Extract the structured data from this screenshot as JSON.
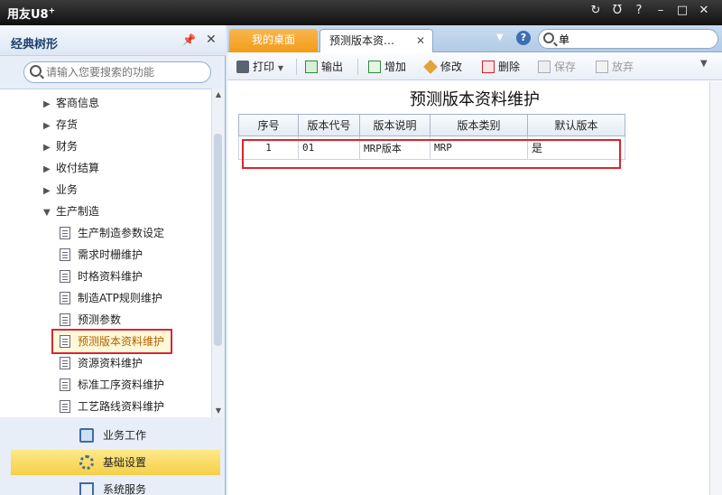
{
  "window": {
    "logo": "用友U8",
    "logo_sup": "+",
    "controls": [
      "↻",
      "Ʊ",
      "?",
      "–",
      "□",
      "✕"
    ]
  },
  "left_panel": {
    "title": "经典树形",
    "search_placeholder": "请输入您要搜索的功能",
    "tree": [
      {
        "label": "客商信息",
        "level": 1,
        "expanded": false
      },
      {
        "label": "存货",
        "level": 1,
        "expanded": false
      },
      {
        "label": "财务",
        "level": 1,
        "expanded": false
      },
      {
        "label": "收付结算",
        "level": 1,
        "expanded": false
      },
      {
        "label": "业务",
        "level": 1,
        "expanded": false
      },
      {
        "label": "生产制造",
        "level": 1,
        "expanded": true
      },
      {
        "label": "生产制造参数设定",
        "level": 2
      },
      {
        "label": "需求时栅维护",
        "level": 2
      },
      {
        "label": "时格资料维护",
        "level": 2
      },
      {
        "label": "制造ATP规则维护",
        "level": 2
      },
      {
        "label": "预测参数",
        "level": 2
      },
      {
        "label": "预测版本资料维护",
        "level": 2,
        "selected": true
      },
      {
        "label": "资源资料维护",
        "level": 2
      },
      {
        "label": "标准工序资料维护",
        "level": 2
      },
      {
        "label": "工艺路线资料维护",
        "level": 2
      }
    ],
    "nav_sections": [
      {
        "label": "业务工作",
        "icon": "briefcase-icon",
        "active": false
      },
      {
        "label": "基础设置",
        "icon": "gear-icon",
        "active": true
      },
      {
        "label": "系统服务",
        "icon": "service-icon",
        "active": false
      }
    ]
  },
  "tabs": [
    {
      "label": "我的桌面",
      "active": false
    },
    {
      "label": "预测版本资…",
      "active": true
    }
  ],
  "top_search": {
    "value": "单"
  },
  "toolbar": {
    "print": "打印",
    "export": "输出",
    "add": "增加",
    "edit": "修改",
    "delete": "删除",
    "save": "保存",
    "discard": "放弃"
  },
  "page": {
    "title": "预测版本资料维护",
    "columns": [
      "序号",
      "版本代号",
      "版本说明",
      "版本类别",
      "默认版本"
    ],
    "rows": [
      [
        "1",
        "01",
        "MRP版本",
        "MRP",
        "是"
      ]
    ]
  },
  "colors": {
    "home_tab": "#f39c1a",
    "highlight_red": "#d8262e",
    "active_nav": "#f6cf46"
  }
}
